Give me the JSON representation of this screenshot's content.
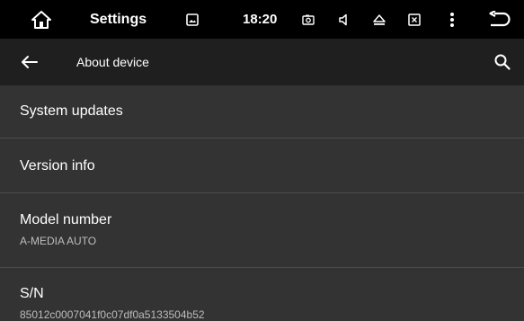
{
  "status_bar": {
    "title": "Settings",
    "time": "18:20",
    "icons": [
      "home-icon",
      "image-icon",
      "screenshot-icon",
      "volume-icon",
      "eject-icon",
      "close-box-icon",
      "more-vert-icon",
      "back-return-icon"
    ]
  },
  "app_bar": {
    "title": "About device",
    "icons": [
      "arrow-back-icon",
      "search-icon"
    ]
  },
  "list": {
    "items": [
      {
        "title": "System updates"
      },
      {
        "title": "Version info"
      },
      {
        "title": "Model number",
        "subtitle": "A-MEDIA AUTO"
      },
      {
        "title": "S/N",
        "subtitle": "85012c0007041f0c07df0a5133504b52"
      }
    ]
  },
  "colors": {
    "status_bar_bg": "#000000",
    "app_bar_bg": "#1f1f1f",
    "list_bg": "#333333",
    "divider": "#4a4a4a",
    "secondary_text": "#bdbdbd"
  }
}
